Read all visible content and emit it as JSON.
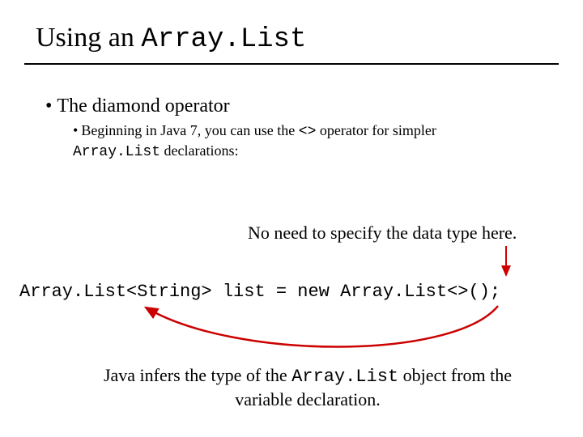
{
  "title": {
    "prefix": "Using an ",
    "code": "Array.List"
  },
  "bullets": {
    "level1": "The diamond operator",
    "level2_pre": "Beginning in Java 7, you can use the ",
    "level2_op": "<>",
    "level2_mid": " operator for simpler ",
    "level2_code": "Array.List",
    "level2_post": " declarations:"
  },
  "note_top": "No need to specify the data type here.",
  "code_line": "Array.List<String> list = new Array.List<>();",
  "note_bottom_pre": "Java infers the type of the ",
  "note_bottom_code": "Array.List",
  "note_bottom_post": " object from the variable declaration.",
  "colors": {
    "arrow": "#cc0000"
  }
}
